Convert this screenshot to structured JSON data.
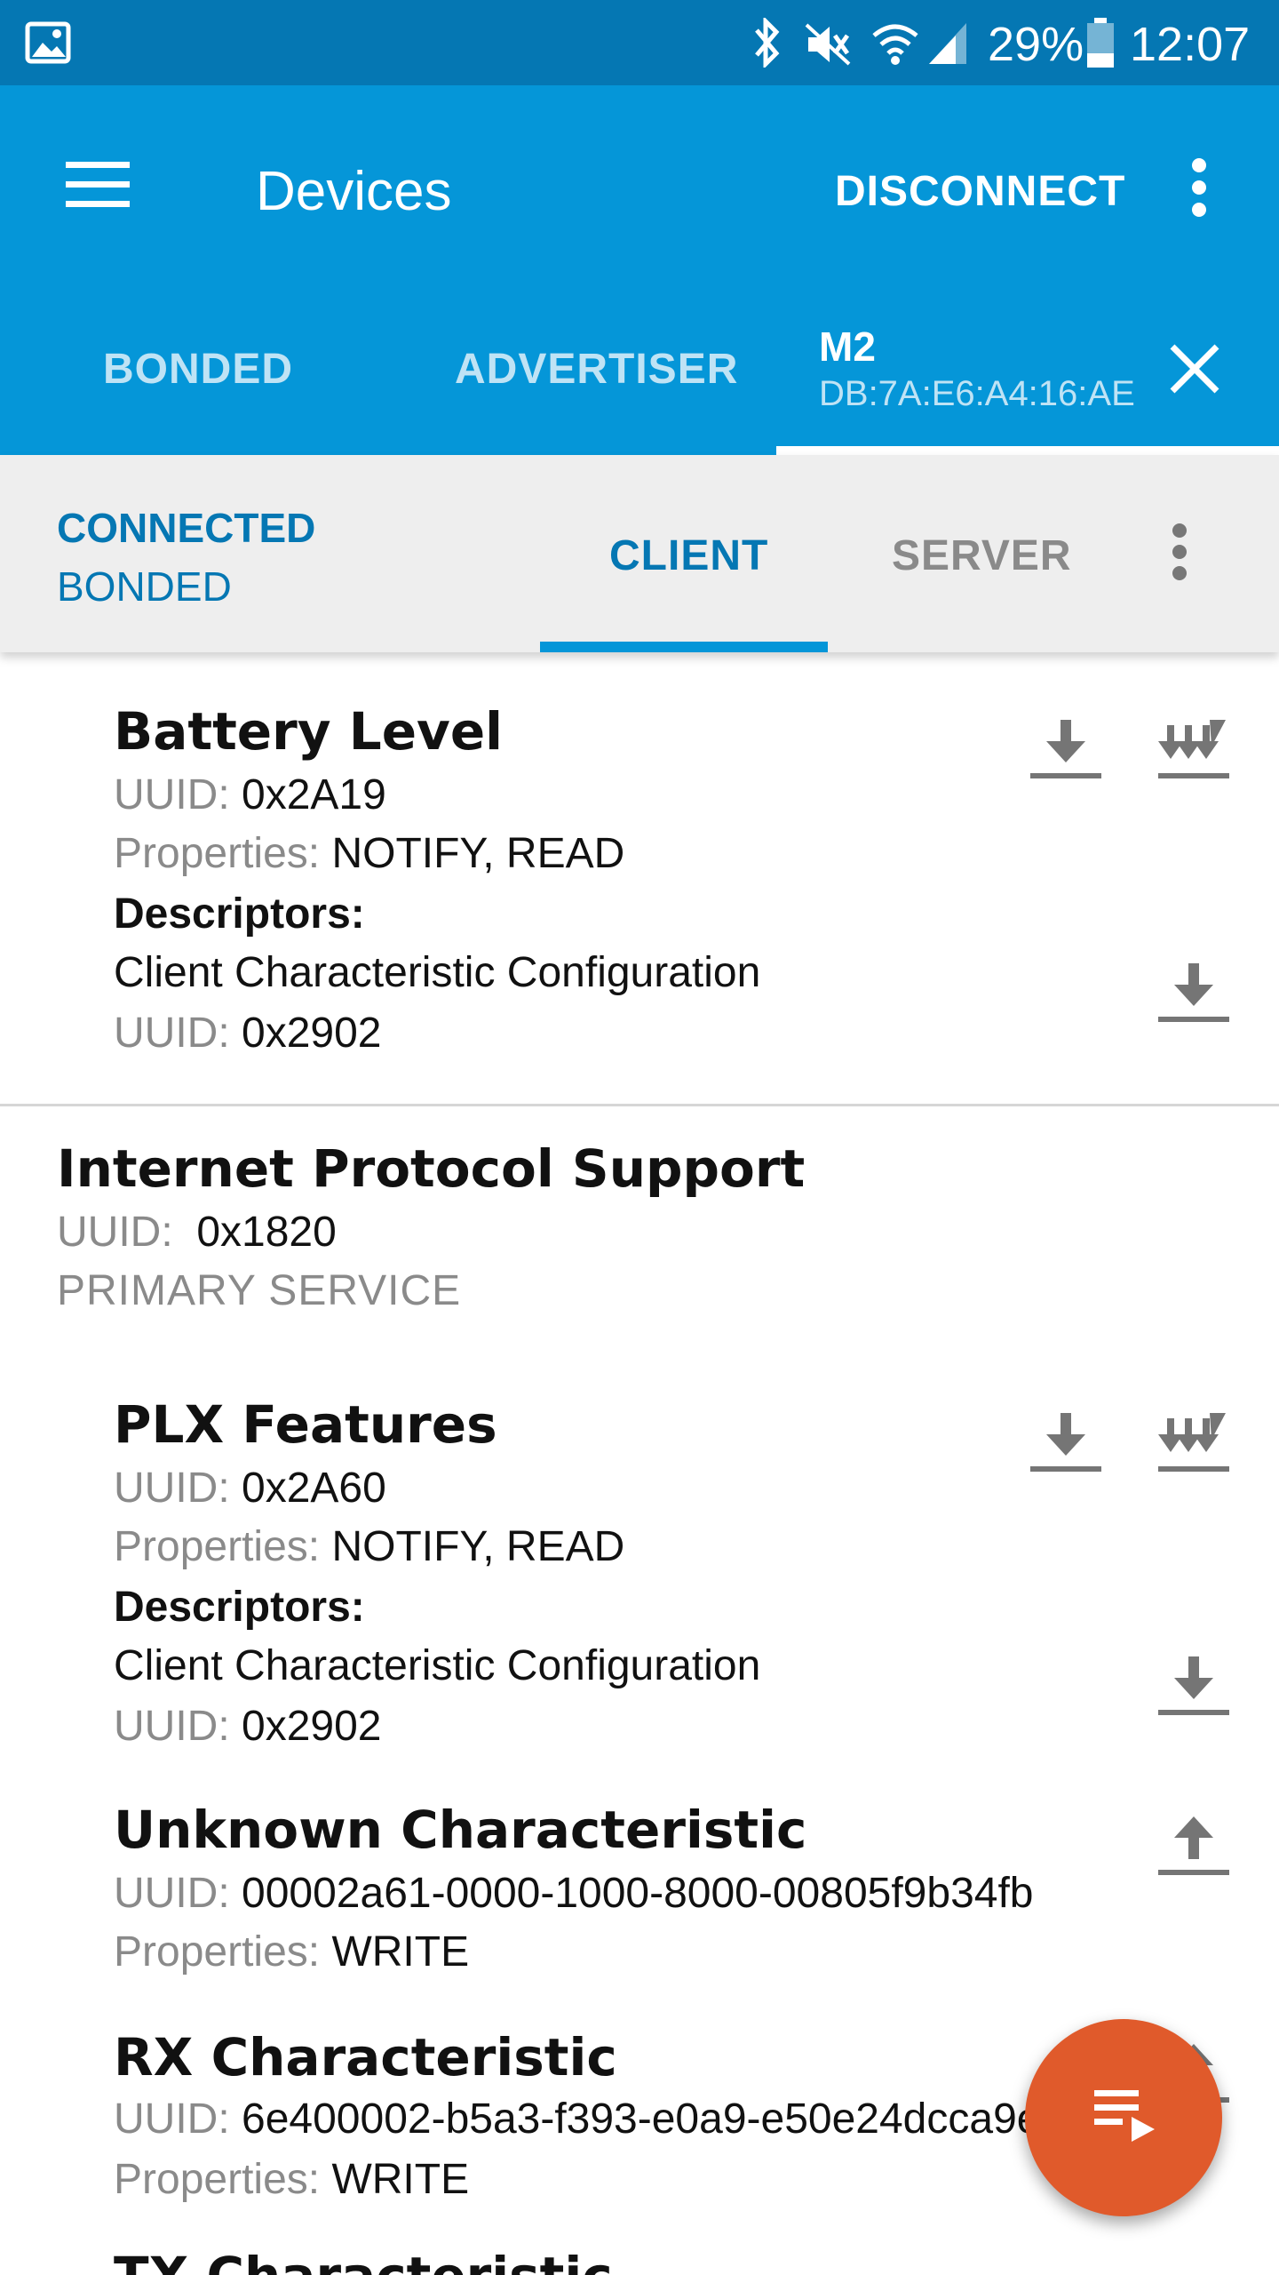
{
  "status_bar": {
    "battery": "29%",
    "time": "12:07"
  },
  "app_bar": {
    "title": "Devices",
    "disconnect": "DISCONNECT"
  },
  "device_tabs": {
    "bonded": "BONDED",
    "advertiser": "ADVERTISER",
    "selected_name": "M2",
    "selected_address": "DB:7A:E6:A4:16:AE"
  },
  "connection": {
    "state": "CONNECTED",
    "bond": "BONDED",
    "client_tab": "CLIENT",
    "server_tab": "SERVER"
  },
  "labels": {
    "uuid": "UUID:",
    "properties": "Properties:",
    "descriptors": "Descriptors:"
  },
  "characteristics": [
    {
      "name": "Battery Level",
      "uuid": "0x2A19",
      "properties": "NOTIFY, READ",
      "descriptor_name": "Client Characteristic Configuration",
      "descriptor_uuid": "0x2902"
    },
    {
      "name": "PLX Features",
      "uuid": "0x2A60",
      "properties": "NOTIFY, READ",
      "descriptor_name": "Client Characteristic Configuration",
      "descriptor_uuid": "0x2902"
    },
    {
      "name": "Unknown Characteristic",
      "uuid": "00002a61-0000-1000-8000-00805f9b34fb",
      "properties": "WRITE"
    },
    {
      "name": "RX Characteristic",
      "uuid": "6e400002-b5a3-f393-e0a9-e50e24dcca9e",
      "properties": "WRITE"
    },
    {
      "name": "TX Characteristic"
    }
  ],
  "service": {
    "name": "Internet Protocol Support",
    "uuid_label": "UUID:",
    "uuid": "0x1820",
    "type": "PRIMARY SERVICE"
  },
  "colors": {
    "status_bar": "#0577b3",
    "app_bar": "#0596d8",
    "fab": "#e05a2b"
  }
}
